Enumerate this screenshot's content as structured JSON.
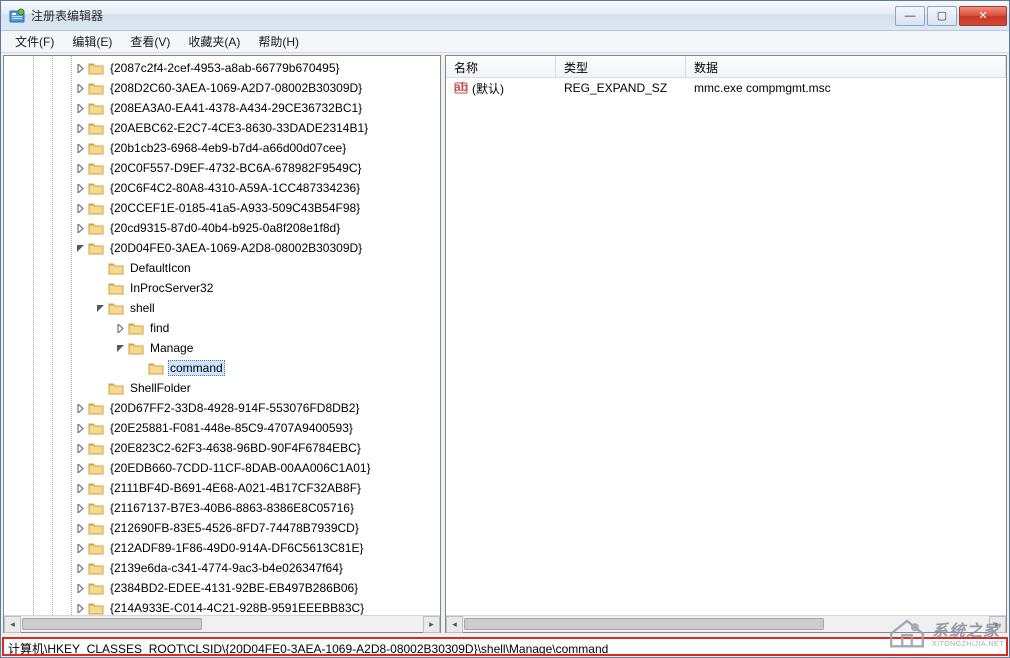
{
  "window": {
    "title": "注册表编辑器",
    "buttons": {
      "min": "—",
      "max": "▢",
      "close": "✕"
    }
  },
  "menu": {
    "file": "文件(F)",
    "edit": "编辑(E)",
    "view": "查看(V)",
    "favorites": "收藏夹(A)",
    "help": "帮助(H)"
  },
  "tree": {
    "indent_base": 70,
    "items": [
      {
        "d": 0,
        "exp": "closed",
        "label": "{2087c2f4-2cef-4953-a8ab-66779b670495}"
      },
      {
        "d": 0,
        "exp": "closed",
        "label": "{208D2C60-3AEA-1069-A2D7-08002B30309D}"
      },
      {
        "d": 0,
        "exp": "closed",
        "label": "{208EA3A0-EA41-4378-A434-29CE36732BC1}"
      },
      {
        "d": 0,
        "exp": "closed",
        "label": "{20AEBC62-E2C7-4CE3-8630-33DADE2314B1}"
      },
      {
        "d": 0,
        "exp": "closed",
        "label": "{20b1cb23-6968-4eb9-b7d4-a66d00d07cee}"
      },
      {
        "d": 0,
        "exp": "closed",
        "label": "{20C0F557-D9EF-4732-BC6A-678982F9549C}"
      },
      {
        "d": 0,
        "exp": "closed",
        "label": "{20C6F4C2-80A8-4310-A59A-1CC487334236}"
      },
      {
        "d": 0,
        "exp": "closed",
        "label": "{20CCEF1E-0185-41a5-A933-509C43B54F98}"
      },
      {
        "d": 0,
        "exp": "closed",
        "label": "{20cd9315-87d0-40b4-b925-0a8f208e1f8d}"
      },
      {
        "d": 0,
        "exp": "open",
        "label": "{20D04FE0-3AEA-1069-A2D8-08002B30309D}"
      },
      {
        "d": 1,
        "exp": "none",
        "label": "DefaultIcon"
      },
      {
        "d": 1,
        "exp": "none",
        "label": "InProcServer32"
      },
      {
        "d": 1,
        "exp": "open",
        "label": "shell"
      },
      {
        "d": 2,
        "exp": "closed",
        "label": "find"
      },
      {
        "d": 2,
        "exp": "open",
        "label": "Manage"
      },
      {
        "d": 3,
        "exp": "none",
        "label": "command",
        "selected": true
      },
      {
        "d": 1,
        "exp": "none",
        "label": "ShellFolder"
      },
      {
        "d": 0,
        "exp": "closed",
        "label": "{20D67FF2-33D8-4928-914F-553076FD8DB2}"
      },
      {
        "d": 0,
        "exp": "closed",
        "label": "{20E25881-F081-448e-85C9-4707A9400593}"
      },
      {
        "d": 0,
        "exp": "closed",
        "label": "{20E823C2-62F3-4638-96BD-90F4F6784EBC}"
      },
      {
        "d": 0,
        "exp": "closed",
        "label": "{20EDB660-7CDD-11CF-8DAB-00AA006C1A01}"
      },
      {
        "d": 0,
        "exp": "closed",
        "label": "{2111BF4D-B691-4E68-A021-4B17CF32AB8F}"
      },
      {
        "d": 0,
        "exp": "closed",
        "label": "{21167137-B7E3-40B6-8863-8386E8C05716}"
      },
      {
        "d": 0,
        "exp": "closed",
        "label": "{212690FB-83E5-4526-8FD7-74478B7939CD}"
      },
      {
        "d": 0,
        "exp": "closed",
        "label": "{212ADF89-1F86-49D0-914A-DF6C5613C81E}"
      },
      {
        "d": 0,
        "exp": "closed",
        "label": "{2139e6da-c341-4774-9ac3-b4e026347f64}"
      },
      {
        "d": 0,
        "exp": "closed",
        "label": "{2384BD2-EDEE-4131-92BE-EB497B286B06}"
      },
      {
        "d": 0,
        "exp": "closed",
        "label": "{214A933E-C014-4C21-928B-9591EEEBB83C}"
      }
    ]
  },
  "list": {
    "headers": {
      "name": "名称",
      "type": "类型",
      "data": "数据"
    },
    "rows": [
      {
        "name": "(默认)",
        "type": "REG_EXPAND_SZ",
        "data": "mmc.exe compmgmt.msc"
      }
    ]
  },
  "status": {
    "path": "计算机\\HKEY_CLASSES_ROOT\\CLSID\\{20D04FE0-3AEA-1069-A2D8-08002B30309D}\\shell\\Manage\\command"
  },
  "watermark": {
    "text": "系统之家",
    "url": "XITONGZHIJIA.NET"
  },
  "colors": {
    "selection": "#cfe3f9",
    "highlight_border": "#d92c1f",
    "folder": "#f3ce74"
  }
}
